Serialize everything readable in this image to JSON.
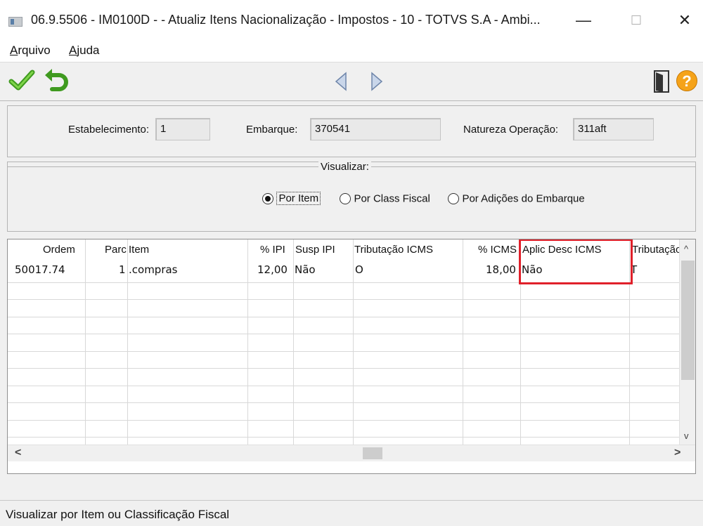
{
  "window": {
    "title": "06.9.5506 - IM0100D -  - Atualiz Itens Nacionalização - Impostos - 10 - TOTVS S.A - Ambi...",
    "minimize": "—",
    "maximize": "☐",
    "close": "✕"
  },
  "menu": [
    {
      "access": "A",
      "rest": "rquivo"
    },
    {
      "access": "A",
      "rest": "juda"
    }
  ],
  "toolbar": {
    "icons": [
      "check-icon",
      "undo-icon",
      "prev-arrow-icon",
      "next-arrow-icon",
      "exit-door-icon",
      "help-icon"
    ],
    "help_glyph": "?"
  },
  "header": {
    "estabelecimento_label": "Estabelecimento:",
    "estabelecimento_value": "1",
    "embarque_label": "Embarque:",
    "embarque_value": "370541",
    "natureza_label": "Natureza Operação:",
    "natureza_value": "311aft"
  },
  "visualizar": {
    "legend": "Visualizar:",
    "options": [
      "Por Item",
      "Por Class Fiscal",
      "Por Adições do Embarque"
    ],
    "selected": 0
  },
  "grid": {
    "columns": [
      "Ordem",
      "Parc",
      "Item",
      "% IPI",
      "Susp IPI",
      "Tributação ICMS",
      "% ICMS",
      "Aplic Desc ICMS",
      "Tributação"
    ],
    "rows": [
      [
        "50017.74",
        "1",
        ".compras",
        "12,00",
        "Não",
        "O",
        "18,00",
        "Não",
        "T"
      ]
    ],
    "highlight_color": "#e0202a",
    "scroll_up": "^",
    "scroll_down": "v",
    "scroll_left": "<",
    "scroll_right": ">"
  },
  "status_bar": {
    "text": "Visualizar por Item ou Classificação Fiscal"
  }
}
